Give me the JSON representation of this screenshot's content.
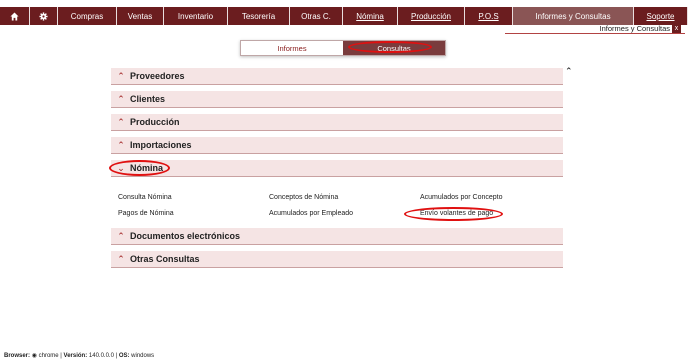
{
  "nav": {
    "items": [
      {
        "label": "",
        "icon": "home-icon"
      },
      {
        "label": "",
        "icon": "gear-icon"
      },
      {
        "label": "Compras"
      },
      {
        "label": "Ventas"
      },
      {
        "label": "Inventario"
      },
      {
        "label": "Tesorería"
      },
      {
        "label": "Otras C."
      },
      {
        "label": "Nómina"
      },
      {
        "label": "Producción"
      },
      {
        "label": "P.O.S"
      },
      {
        "label": "Informes y Consultas"
      },
      {
        "label": "Soporte"
      }
    ]
  },
  "breadcrumb": {
    "label": "Informes y Consultas",
    "close": "x"
  },
  "toggle": {
    "informes": "Informes",
    "consultas": "Consultas"
  },
  "scroll_icon": "chevron-up-icon",
  "sections": {
    "proveedores": "Proveedores",
    "clientes": "Clientes",
    "produccion": "Producción",
    "importaciones": "Importaciones",
    "nomina": "Nómina",
    "documentos": "Documentos electrónicos",
    "otras": "Otras Consultas"
  },
  "nomina_links": {
    "consulta": "Consulta Nómina",
    "conceptos": "Conceptos de Nómina",
    "acum_concepto": "Acumulados por Concepto",
    "pagos": "Pagos de Nómina",
    "acum_empleado": "Acumulados por Empleado",
    "envio": "Envío volantes de pago"
  },
  "footer": {
    "browser_label": "Browser:",
    "browser": "chrome",
    "version_label": "Versión:",
    "version": "140.0.0.0",
    "os_label": "OS:",
    "os": "windows"
  },
  "colors": {
    "nav_bg": "#6b1d1f",
    "nav_active": "#8a5555",
    "section_bg": "#f5e4e4",
    "highlight": "#e01010"
  }
}
